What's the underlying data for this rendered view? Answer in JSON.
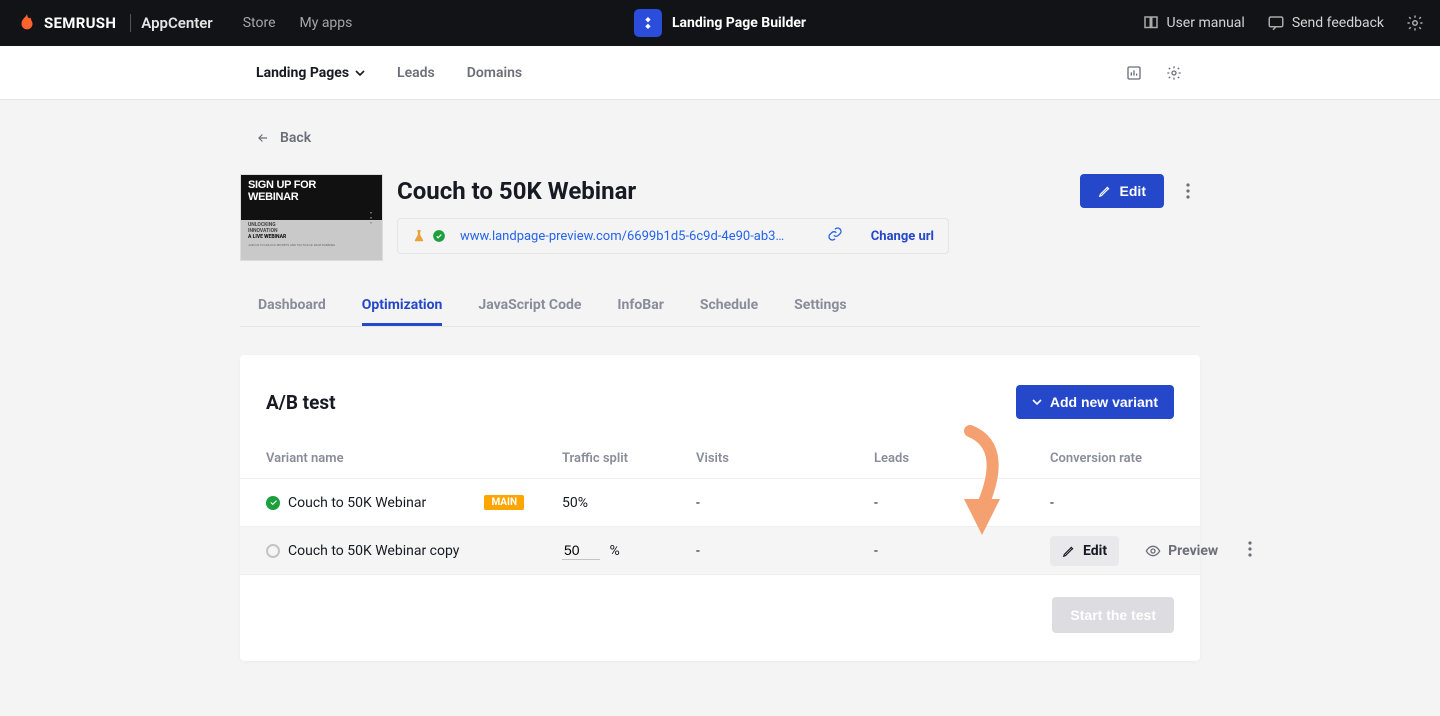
{
  "header": {
    "brand_main": "SEMRUSH",
    "brand_sub": "AppCenter",
    "nav": {
      "store": "Store",
      "myapps": "My apps"
    },
    "app_title": "Landing Page Builder",
    "right": {
      "manual": "User manual",
      "feedback": "Send feedback"
    }
  },
  "subnav": {
    "landing_pages": "Landing Pages",
    "leads": "Leads",
    "domains": "Domains"
  },
  "back_label": "Back",
  "page_title": "Couch to 50K Webinar",
  "edit_button": "Edit",
  "thumb": {
    "l1": "SIGN UP FOR",
    "l2": "WEBINAR",
    "s1a": "UNLOCKING",
    "s1b": "INNOVATION",
    "s2": "A LIVE WEBINAR",
    "s3": "JOIN US TO UNLOCK SECRETS AND TACTICS OF RACE RUNNING"
  },
  "url": {
    "text": "www.landpage-preview.com/6699b1d5-6c9d-4e90-ab3…",
    "change": "Change url"
  },
  "tabs": {
    "dashboard": "Dashboard",
    "optimization": "Optimization",
    "javascript": "JavaScript Code",
    "infobar": "InfoBar",
    "schedule": "Schedule",
    "settings": "Settings"
  },
  "panel": {
    "title": "A/B test",
    "add_variant": "Add new variant",
    "headers": {
      "name": "Variant name",
      "split": "Traffic split",
      "visits": "Visits",
      "leads": "Leads",
      "conv": "Conversion rate"
    },
    "rows": [
      {
        "name": "Couch to 50K Webinar",
        "main_badge": "MAIN",
        "split": "50%",
        "visits": "-",
        "leads": "-",
        "conv": "-"
      },
      {
        "name": "Couch to 50K Webinar copy",
        "split_value": "50",
        "split_suffix": "%",
        "visits": "-",
        "leads": "-",
        "conv": "-"
      }
    ],
    "row_actions": {
      "edit": "Edit",
      "preview": "Preview"
    },
    "start_test": "Start the test"
  }
}
